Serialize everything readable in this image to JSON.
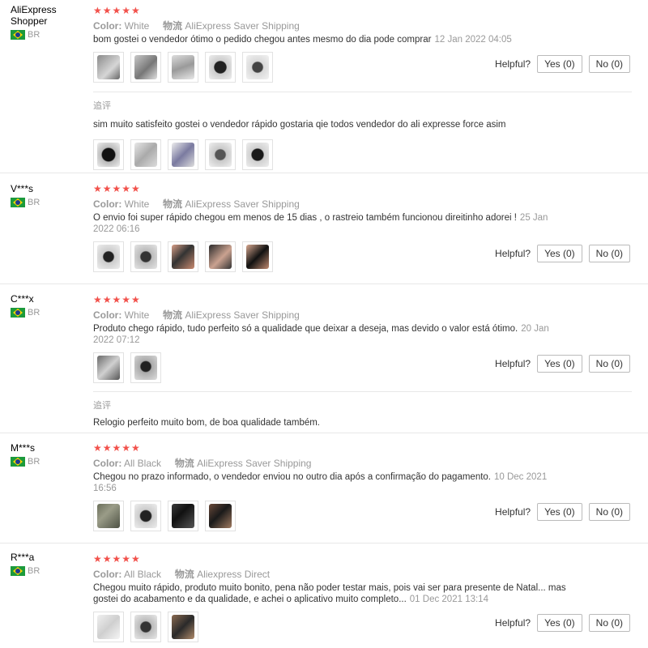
{
  "labels": {
    "color": "Color:",
    "shipping": "物流",
    "helpful": "Helpful?",
    "yes": "Yes (0)",
    "no": "No (0)",
    "followup": "追评"
  },
  "colors": {
    "star": "#f2514b",
    "muted": "#999999",
    "text": "#333333"
  },
  "reviews": [
    {
      "user": "AliExpress Shopper",
      "country": "BR",
      "stars": "★★★★★",
      "color_value": "White",
      "shipping_value": "AliExpress Saver Shipping",
      "text": "bom gostei o vendedor ótimo o pedido chegou antes mesmo do dia pode comprar",
      "date": "12 Jan 2022 04:05",
      "photos": 5,
      "followup_text": "sim muito satisfeito gostei o vendedor rápido gostaria qie todos vendedor do ali expresse force asim",
      "followup_photos": 5
    },
    {
      "user": "V***s",
      "country": "BR",
      "stars": "★★★★★",
      "color_value": "White",
      "shipping_value": "AliExpress Saver Shipping",
      "text": "O envio foi super rápido chegou em menos de 15 dias , o rastreio também funcionou direitinho adorei !",
      "date": "25 Jan 2022 06:16",
      "photos": 5
    },
    {
      "user": "C***x",
      "country": "BR",
      "stars": "★★★★★",
      "color_value": "White",
      "shipping_value": "AliExpress Saver Shipping",
      "text": "Produto chego rápido, tudo perfeito só a qualidade que deixar a deseja, mas devido o valor está ótimo.",
      "date": "20 Jan 2022 07:12",
      "photos": 2,
      "followup_text": "Relogio perfeito muito bom, de boa qualidade também."
    },
    {
      "user": "M***s",
      "country": "BR",
      "stars": "★★★★★",
      "color_value": "All Black",
      "shipping_value": "AliExpress Saver Shipping",
      "text": "Chegou no prazo informado, o vendedor enviou no outro dia após a confirmação do pagamento.",
      "date": "10 Dec 2021 16:56",
      "photos": 4
    },
    {
      "user": "R***a",
      "country": "BR",
      "stars": "★★★★★",
      "color_value": "All Black",
      "shipping_value": "Aliexpress Direct",
      "text": "Chegou muito rápido, produto muito bonito, pena não poder testar mais, pois vai ser para presente de Natal... mas gostei do acabamento e da qualidade, e achei o aplicativo muito completo...",
      "date": "01 Dec 2021 13:14",
      "photos": 3
    }
  ]
}
